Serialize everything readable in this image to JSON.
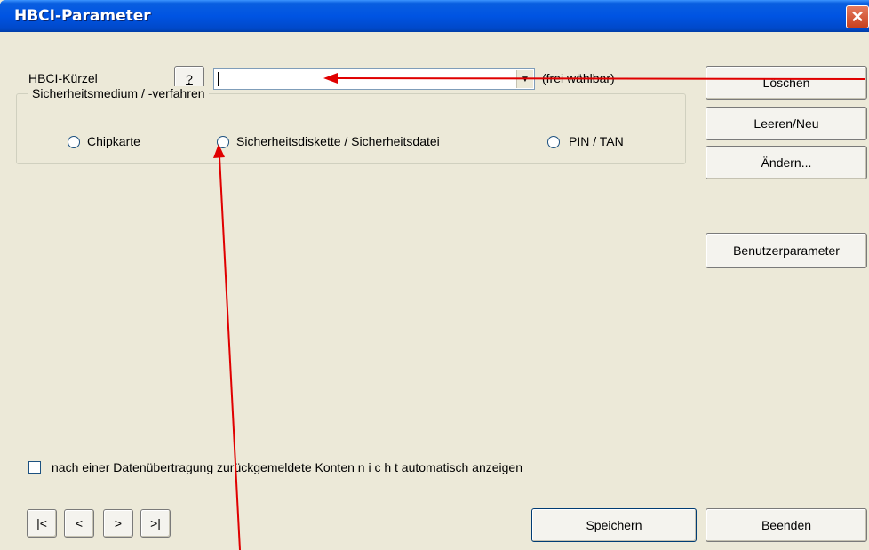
{
  "window": {
    "title": "HBCI-Parameter",
    "close_glyph": "✕"
  },
  "fields": {
    "kuerzel_label": "HBCI-Kürzel",
    "help_label": "?",
    "kuerzel_value": "",
    "kuerzel_arrow": "▼",
    "kuerzel_hint": "(frei wählbar)"
  },
  "security_group": {
    "legend": "Sicherheitsmedium / -verfahren",
    "options": [
      "Chipkarte",
      "Sicherheitsdiskette / Sicherheitsdatei",
      "PIN / TAN"
    ]
  },
  "side_buttons": {
    "delete": "Löschen",
    "clear_new": "Leeren/Neu",
    "change": "Ändern...",
    "user_params": "Benutzerparameter"
  },
  "checkbox": {
    "label": "nach einer Datenübertragung zurückgemeldete Konten  n i c h t  automatisch anzeigen",
    "checked": false
  },
  "nav": {
    "first": "|<",
    "prev": "<",
    "next": ">",
    "last": ">|"
  },
  "bottom_buttons": {
    "save": "Speichern",
    "exit": "Beenden"
  },
  "annotation": {
    "arrow_color": "#E00000"
  }
}
